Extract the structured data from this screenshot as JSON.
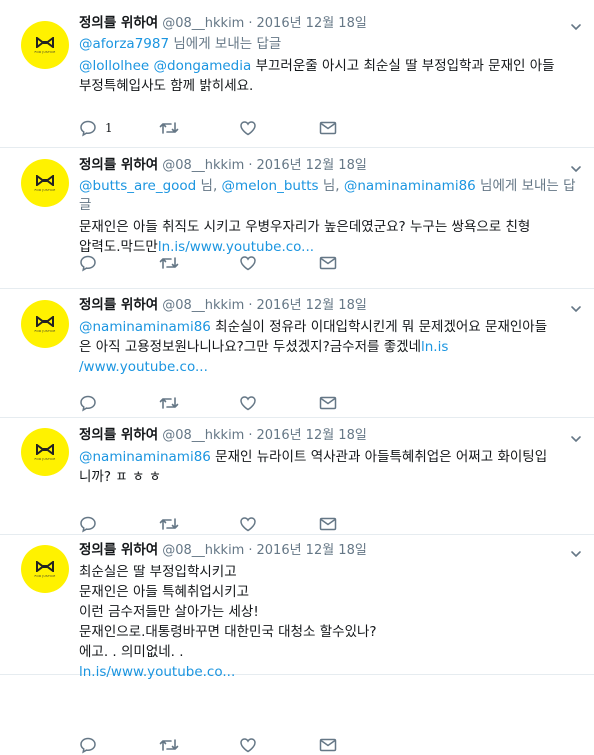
{
  "tweets": [
    {
      "name": "정의를 위하여",
      "handle": "@08__hkkim",
      "date": "2016년 12월 18일",
      "reply_to": "@aforza7987",
      "reply_suffix": " 님에게 보내는 답글",
      "lines": [
        [
          {
            "t": "mention",
            "v": "@lollolhee"
          },
          {
            "t": "text",
            "v": " "
          },
          {
            "t": "mention",
            "v": "@dongamedia"
          },
          {
            "t": "text",
            "v": " 부끄러운줄 아시고 최순실 딸 부정입학과 문재인 아들"
          }
        ],
        [
          {
            "t": "text",
            "v": "부정특혜입사도 함께 밝히세요."
          }
        ]
      ],
      "reply_count": "1"
    },
    {
      "name": "정의를 위하여",
      "handle": "@08__hkkim",
      "date": "2016년 12월 18일",
      "reply_parts": [
        {
          "t": "mention",
          "v": "@butts_are_good"
        },
        {
          "t": "text",
          "v": " 님, "
        },
        {
          "t": "mention",
          "v": "@melon_butts"
        },
        {
          "t": "text",
          "v": " 님, "
        },
        {
          "t": "mention",
          "v": "@naminaminami86"
        },
        {
          "t": "text",
          "v": " 님에게 보내는 답글"
        }
      ],
      "lines": [
        [
          {
            "t": "text",
            "v": "문재인은 아들 취직도 시키고 우병우자리가 높은데였군요? 누구는 쌍욕으로 친형"
          }
        ],
        [
          {
            "t": "text",
            "v": "압력도.막드만"
          },
          {
            "t": "link",
            "v": "ln.is/www.youtube.co..."
          }
        ]
      ],
      "reply_count": ""
    },
    {
      "name": "정의를 위하여",
      "handle": "@08__hkkim",
      "date": "2016년 12월 18일",
      "lines": [
        [
          {
            "t": "mention",
            "v": "@naminaminami86"
          },
          {
            "t": "text",
            "v": " 최순실이 정유라 이대입학시킨게 뭐 문제겠어요 문재인아들"
          }
        ],
        [
          {
            "t": "text",
            "v": "은 아직 고용정보원나니나요?그만 두셨겠지?금수저를 좋겠네"
          },
          {
            "t": "link",
            "v": "ln.is"
          }
        ],
        [
          {
            "t": "link",
            "v": "/www.youtube.co..."
          }
        ]
      ],
      "reply_count": ""
    },
    {
      "name": "정의를 위하여",
      "handle": "@08__hkkim",
      "date": "2016년 12월 18일",
      "lines": [
        [
          {
            "t": "mention",
            "v": "@naminaminami86"
          },
          {
            "t": "text",
            "v": " 문재인 뉴라이트 역사관과 아들특혜취업은 어쩌고 화이팅입"
          }
        ],
        [
          {
            "t": "text",
            "v": "니까? ㅍ ㅎ ㅎ"
          }
        ]
      ],
      "reply_count": ""
    },
    {
      "name": "정의를 위하여",
      "handle": "@08__hkkim",
      "date": "2016년 12월 18일",
      "lines": [
        [
          {
            "t": "text",
            "v": "최순실은 딸 부정입학시키고"
          }
        ],
        [
          {
            "t": "text",
            "v": "문재인은 아들 특혜취업시키고"
          }
        ],
        [
          {
            "t": "text",
            "v": "이런 금수저들만 살아가는 세상!"
          }
        ],
        [
          {
            "t": "text",
            "v": "문재인으로.대통령바꾸면 대한민국 대청소 할수있나?"
          }
        ],
        [
          {
            "t": "text",
            "v": "에고. . 의미없네. ."
          }
        ],
        [
          {
            "t": "link",
            "v": "ln.is/www.youtube.co..."
          }
        ]
      ],
      "reply_count": ""
    }
  ],
  "avatar_caption": "FOR JUSTICE",
  "icons": {
    "avatar": "bow-logo-icon",
    "caret": "chevron-down-icon",
    "reply": "reply-icon",
    "retweet": "retweet-icon",
    "like": "heart-icon",
    "dm": "envelope-icon"
  },
  "colors": {
    "link": "#1b95e0",
    "muted": "#657786",
    "avatar_bg": "#fff200",
    "divider": "#e6ecf0"
  }
}
